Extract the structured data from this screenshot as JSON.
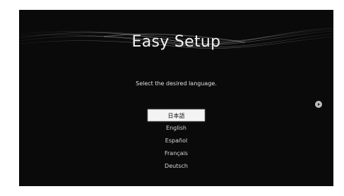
{
  "screen": {
    "title": "Easy Setup",
    "prompt": "Select the desired language."
  },
  "languages": [
    {
      "label": "日本語",
      "selected": true
    },
    {
      "label": "English",
      "selected": false
    },
    {
      "label": "Español",
      "selected": false
    },
    {
      "label": "Français",
      "selected": false
    },
    {
      "label": "Deutsch",
      "selected": false
    }
  ],
  "icons": {
    "next": "circle-arrow-right-icon"
  },
  "colors": {
    "background": "#0a0a0a",
    "text": "#e0e0e0",
    "selected_background": "#f3f3f3"
  }
}
